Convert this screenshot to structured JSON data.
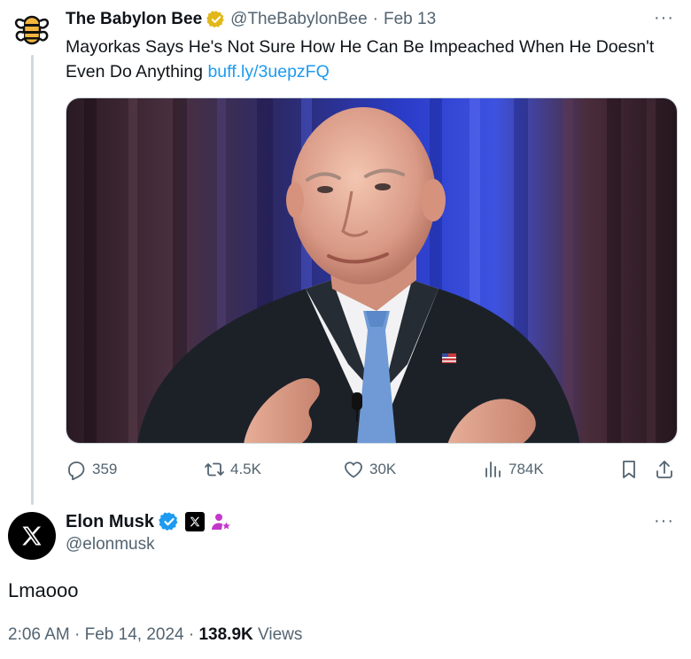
{
  "quoted_tweet": {
    "display_name": "The Babylon Bee",
    "handle": "@TheBabylonBee",
    "separator": "·",
    "date": "Feb 13",
    "text": "Mayorkas Says He's Not Sure How He Can Be Impeached When He Doesn't Even Do Anything ",
    "link": "buff.ly/3uepzFQ",
    "more": "···",
    "actions": {
      "replies": "359",
      "reposts": "4.5K",
      "likes": "30K",
      "views": "784K"
    },
    "avatar_icon": "babylon-bee-logo-icon",
    "badge_icon": "gold-verified-badge-icon",
    "accent_color": "#f4b63f"
  },
  "reply_tweet": {
    "display_name": "Elon Musk",
    "handle": "@elonmusk",
    "more": "···",
    "text": "Lmaooo",
    "time": "2:06 AM",
    "separator": "·",
    "date": "Feb 14, 2024",
    "views_count": "138.9K",
    "views_label": "Views",
    "avatar_icon": "x-logo-icon",
    "badges": [
      "blue-verified-badge-icon",
      "x-affiliate-badge-icon",
      "person-star-icon"
    ],
    "verified_color": "#1d9bf0",
    "person_badge_color": "#c239c9"
  },
  "colors": {
    "link": "#1d9bf0",
    "secondary_text": "#536471",
    "primary_text": "#0f1419",
    "thread_line": "#cfd9de"
  }
}
